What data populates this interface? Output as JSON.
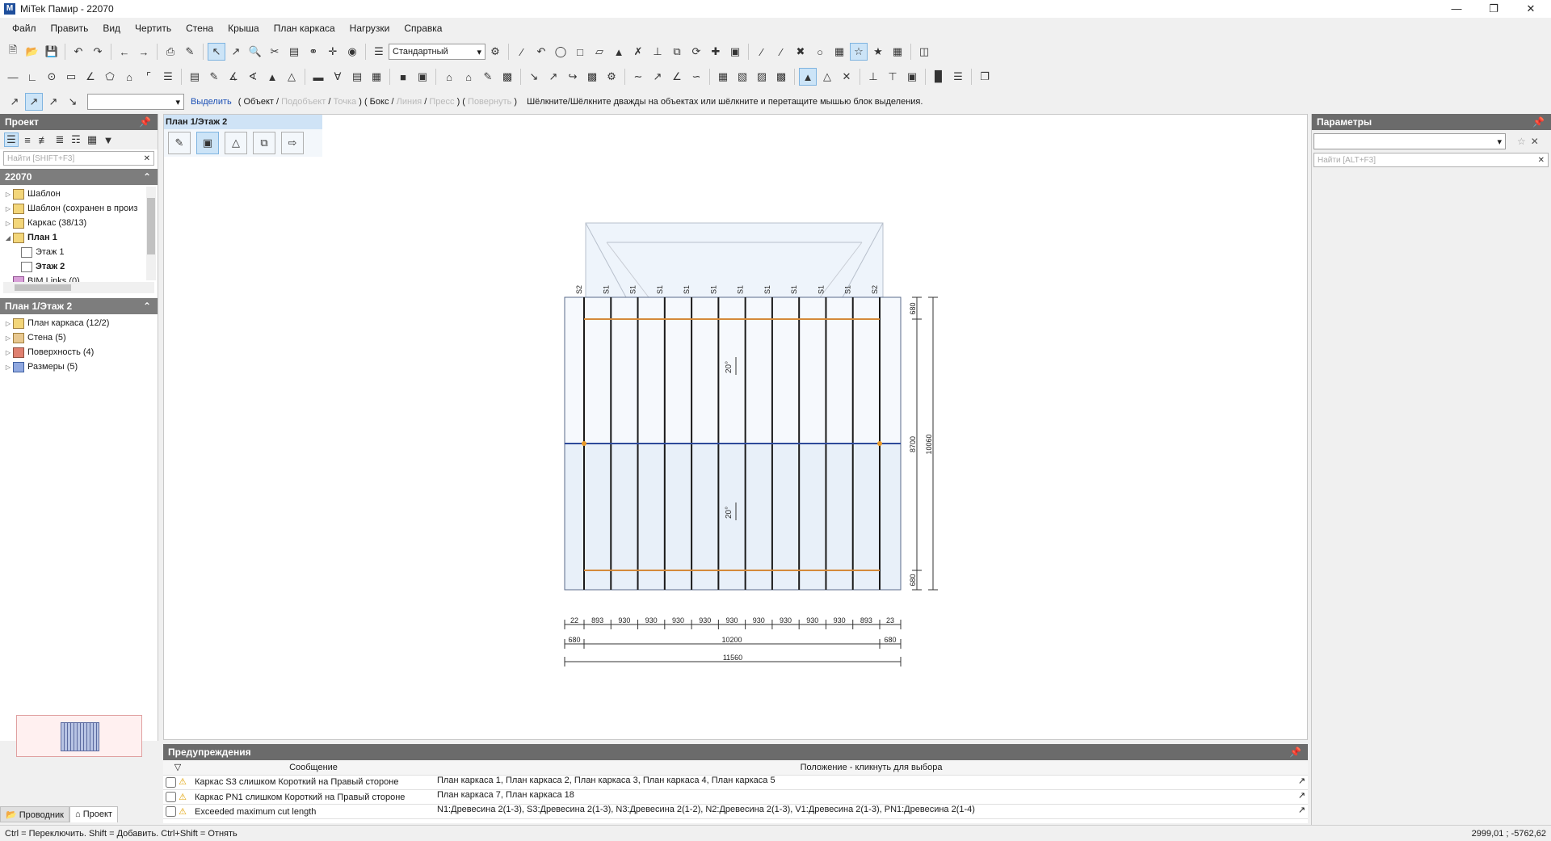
{
  "app": {
    "title": "MiTek Памир - 22070"
  },
  "menu": [
    "Файл",
    "Править",
    "Вид",
    "Чертить",
    "Стена",
    "Крыша",
    "План каркаса",
    "Нагрузки",
    "Справка"
  ],
  "toolbar": {
    "style_combo": "Стандартный"
  },
  "selection_bar": {
    "select_label": "Выделить",
    "items": [
      "( Объект",
      "/",
      "Подобъект",
      "/",
      "Точка",
      ") (",
      "Бокс",
      "/",
      "Линия",
      "/",
      "Пресс",
      ") (",
      "Повернуть",
      ")"
    ],
    "disabled": [
      2,
      4,
      8,
      10,
      12
    ],
    "hint": "Шёлкните/Шёлкните дважды на объектах или шёлкните и перетащите мышью блок выделения."
  },
  "project_panel": {
    "title": "Проект",
    "search_placeholder": "Найти [SHIFT+F3]",
    "project_name": "22070",
    "tree": [
      {
        "label": "Шаблон",
        "indent": 0,
        "bold": false
      },
      {
        "label": "Шаблон (сохранен в произ",
        "indent": 0,
        "bold": false
      },
      {
        "label": "Каркас (38/13)",
        "indent": 0,
        "bold": false
      },
      {
        "label": "План 1",
        "indent": 0,
        "bold": true
      },
      {
        "label": "Этаж 1",
        "indent": 1,
        "bold": false
      },
      {
        "label": "Этаж 2",
        "indent": 1,
        "bold": true
      },
      {
        "label": "BIM Links (0)",
        "indent": 0,
        "bold": false
      }
    ],
    "level_title": "План 1/Этаж 2",
    "level_tree": [
      "План каркаса (12/2)",
      "Стена (5)",
      "Поверхность (4)",
      "Размеры (5)"
    ],
    "tabs": [
      "Проводник",
      "Проект"
    ]
  },
  "view": {
    "tab_title": "План 1/Этаж 2",
    "top_labels": [
      "S2",
      "S1",
      "S1",
      "S1",
      "S1",
      "S1",
      "S1",
      "S1",
      "S1",
      "S1",
      "S1",
      "S2"
    ],
    "bottom_dims": [
      "22",
      "893",
      "930",
      "930",
      "930",
      "930",
      "930",
      "930",
      "930",
      "930",
      "930",
      "893",
      "23"
    ],
    "dim_680_left": "680",
    "dim_10200": "10200",
    "dim_680_right": "680",
    "dim_11560": "11560",
    "right_dims": [
      "680",
      "8700",
      "680"
    ],
    "right_total": "10060",
    "pitch_labels": [
      "20°",
      "20°"
    ]
  },
  "params_panel": {
    "title": "Параметры",
    "search_placeholder": "Найти [ALT+F3]"
  },
  "warnings": {
    "title": "Предупреждения",
    "col_message": "Сообщение",
    "col_location": "Положение - кликнуть для выбора",
    "rows": [
      {
        "message": "Каркас S3 слишком Короткий на Правый стороне",
        "location": "План каркаса 1, План каркаса 2, План каркаса 3, План каркаса 4, План каркаса 5"
      },
      {
        "message": "Каркас PN1 слишком Короткий на Правый стороне",
        "location": "План каркаса 7, План каркаса 18"
      },
      {
        "message": "Exceeded maximum cut length",
        "location": "N1:Древесина 2(1-3), S3:Древесина 2(1-3), N3:Древесина 2(1-2), N2:Древесина 2(1-3), V1:Древесина 2(1-3), PN1:Древесина 2(1-4)"
      }
    ]
  },
  "status": {
    "hint": "Ctrl = Переключить. Shift = Добавить. Ctrl+Shift = Отнять",
    "coords": "2999,01 ; -5762,62"
  }
}
